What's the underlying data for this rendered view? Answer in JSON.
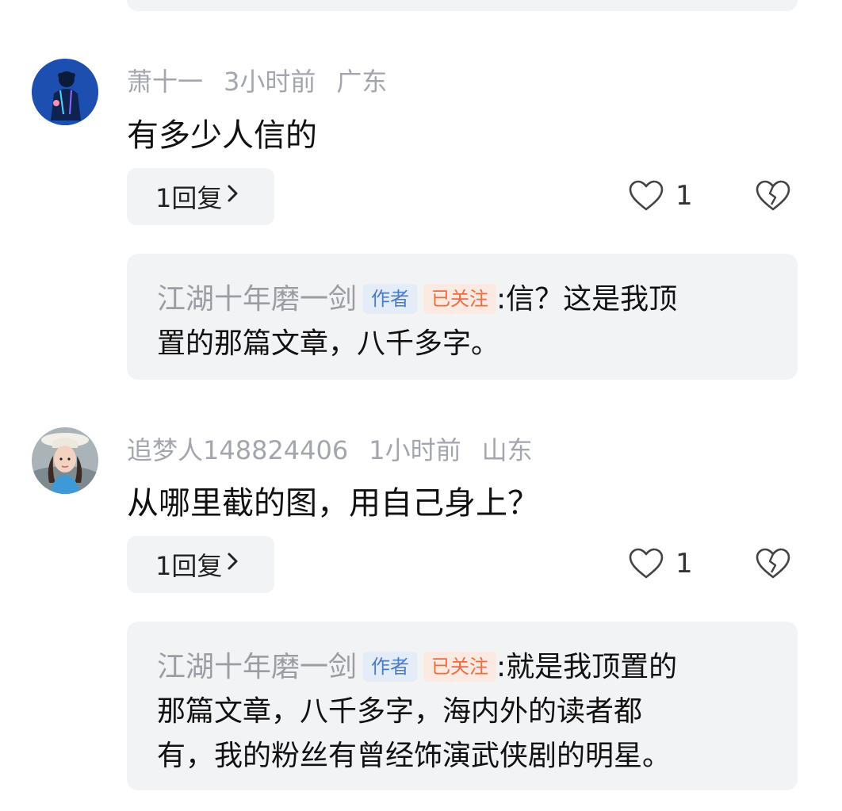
{
  "comments": [
    {
      "username": "萧十一",
      "time": "3小时前",
      "location": "广东",
      "text": "有多少人信的",
      "reply_button": "1回复",
      "likes": "1",
      "reply": {
        "author": "江湖十年磨一剑",
        "badge_author": "作者",
        "badge_follow": "已关注",
        "lines": [
          ":信？这是我顶",
          "置的那篇文章，八千多字。"
        ]
      }
    },
    {
      "username": "追梦人148824406",
      "time": "1小时前",
      "location": "山东",
      "text": "从哪里截的图，用自己身上？",
      "reply_button": "1回复",
      "likes": "1",
      "reply": {
        "author": "江湖十年磨一剑",
        "badge_author": "作者",
        "badge_follow": "已关注",
        "lines": [
          ":就是我顶置的",
          "那篇文章，八千多字，海内外的读者都",
          "有，我的粉丝有曾经饰演武侠剧的明星。"
        ]
      }
    }
  ],
  "icons": {
    "reply_chevron": "chevron-right-icon",
    "like": "heart-outline-icon",
    "dislike": "broken-heart-icon"
  }
}
